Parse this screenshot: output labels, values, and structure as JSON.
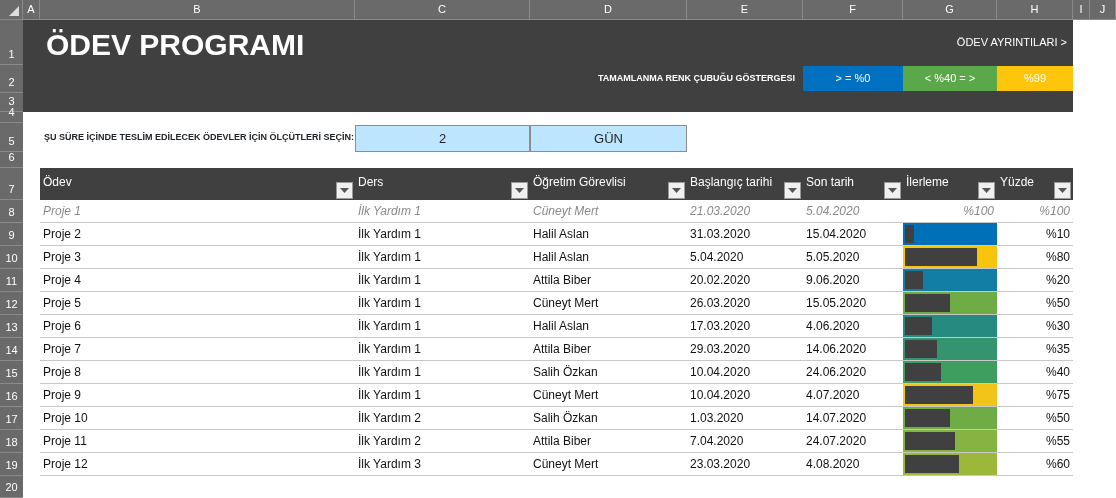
{
  "sheet": {
    "columns": [
      "A",
      "B",
      "C",
      "D",
      "E",
      "F",
      "G",
      "H",
      "I",
      "J"
    ],
    "rows": [
      "1",
      "2",
      "3",
      "4",
      "5",
      "6",
      "7",
      "8",
      "9",
      "10",
      "11",
      "12",
      "13",
      "14",
      "15",
      "16",
      "17",
      "18",
      "19",
      "20"
    ]
  },
  "banner": {
    "title": "ÖDEV PROGRAMI",
    "link": "ÖDEV AYRINTILARI >",
    "legend_label": "TAMAMLANMA RENK ÇUBUĞU GÖSTERGESI",
    "legend": [
      {
        "text": "> = %0",
        "color": "#0070c0"
      },
      {
        "text": "< %40 = >",
        "color": "#5ba84a"
      },
      {
        "text": "%99",
        "color": "#fdc50b"
      }
    ]
  },
  "criteria": {
    "label": "ŞU SÜRE İÇİNDE TESLİM EDİLECEK ÖDEVLER İÇİN ÖLÇÜTLERİ SEÇİN:",
    "value": "2",
    "unit": "GÜN"
  },
  "table": {
    "columns": [
      "Ödev",
      "Ders",
      "Öğretim Görevlisi",
      "Başlangıç tarihi",
      "Son tarih",
      "İlerleme",
      "Yüzde"
    ],
    "rows": [
      {
        "task": "Proje 1",
        "course": "İlk Yardım 1",
        "lecturer": "Cüneyt Mert",
        "start": "21.03.2020",
        "due": "5.04.2020",
        "progress_text": "%100",
        "percent": "%100",
        "done": true
      },
      {
        "task": "Proje 2",
        "course": "İlk Yardım 1",
        "lecturer": "Halil Aslan",
        "start": "31.03.2020",
        "due": "15.04.2020",
        "progress": {
          "level": 0.1,
          "color": "#0070b8"
        },
        "percent": "%10",
        "done": false
      },
      {
        "task": "Proje 3",
        "course": "İlk Yardım 1",
        "lecturer": "Halil Aslan",
        "start": "5.04.2020",
        "due": "5.05.2020",
        "progress": {
          "level": 0.8,
          "color": "#f8c40c"
        },
        "percent": "%80",
        "done": false
      },
      {
        "task": "Proje 4",
        "course": "İlk Yardım 1",
        "lecturer": "Attila Biber",
        "start": "20.02.2020",
        "due": "9.06.2020",
        "progress": {
          "level": 0.2,
          "color": "#127ea6"
        },
        "percent": "%20",
        "done": false
      },
      {
        "task": "Proje 5",
        "course": "İlk Yardım 1",
        "lecturer": "Cüneyt Mert",
        "start": "26.03.2020",
        "due": "15.05.2020",
        "progress": {
          "level": 0.5,
          "color": "#70ac46"
        },
        "percent": "%50",
        "done": false
      },
      {
        "task": "Proje 6",
        "course": "İlk Yardım 1",
        "lecturer": "Halil Aslan",
        "start": "17.03.2020",
        "due": "4.06.2020",
        "progress": {
          "level": 0.3,
          "color": "#278a80"
        },
        "percent": "%30",
        "done": false
      },
      {
        "task": "Proje 7",
        "course": "İlk Yardım 1",
        "lecturer": "Attila Biber",
        "start": "29.03.2020",
        "due": "14.06.2020",
        "progress": {
          "level": 0.35,
          "color": "#33946f"
        },
        "percent": "%35",
        "done": false
      },
      {
        "task": "Proje 8",
        "course": "İlk Yardım 1",
        "lecturer": "Salih Özkan",
        "start": "10.04.2020",
        "due": "24.06.2020",
        "progress": {
          "level": 0.4,
          "color": "#3d9e5f"
        },
        "percent": "%40",
        "done": false
      },
      {
        "task": "Proje 9",
        "course": "İlk Yardım 1",
        "lecturer": "Cüneyt Mert",
        "start": "10.04.2020",
        "due": "4.07.2020",
        "progress": {
          "level": 0.75,
          "color": "#f2c417"
        },
        "percent": "%75",
        "done": false
      },
      {
        "task": "Proje 10",
        "course": "İlk Yardım 2",
        "lecturer": "Salih Özkan",
        "start": "1.03.2020",
        "due": "14.07.2020",
        "progress": {
          "level": 0.5,
          "color": "#70ac46"
        },
        "percent": "%50",
        "done": false
      },
      {
        "task": "Proje 11",
        "course": "İlk Yardım 2",
        "lecturer": "Attila Biber",
        "start": "7.04.2020",
        "due": "24.07.2020",
        "progress": {
          "level": 0.55,
          "color": "#86b440"
        },
        "percent": "%55",
        "done": false
      },
      {
        "task": "Proje 12",
        "course": "İlk Yardım 3",
        "lecturer": "Cüneyt Mert",
        "start": "23.03.2020",
        "due": "4.08.2020",
        "progress": {
          "level": 0.6,
          "color": "#9cb83a"
        },
        "percent": "%60",
        "done": false
      }
    ]
  }
}
